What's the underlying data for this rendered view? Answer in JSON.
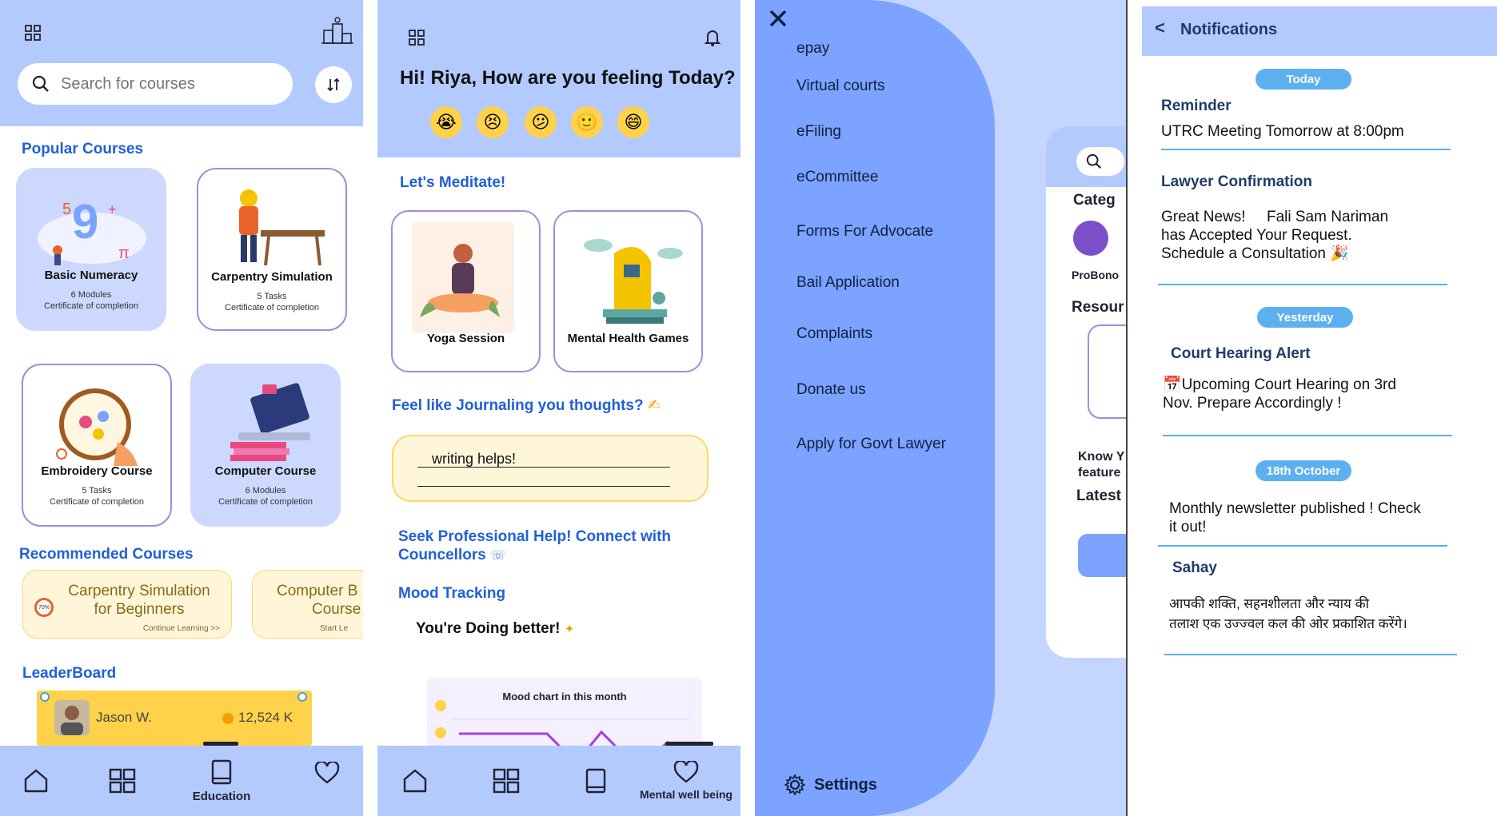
{
  "education": {
    "search_placeholder": "Search for courses",
    "popular_title": "Popular Courses",
    "courses": [
      {
        "name": "Basic Numeracy",
        "line1": "6 Modules",
        "line2": "Certificate of completion"
      },
      {
        "name": "Carpentry Simulation",
        "line1": "5 Tasks",
        "line2": "Certificate of completion"
      },
      {
        "name": "Embroidery Course",
        "line1": "5 Tasks",
        "line2": "Certificate of completion"
      },
      {
        "name": "Computer Course",
        "line1": "6 Modules",
        "line2": "Certificate of completion"
      }
    ],
    "recommended_title": "Recommended Courses",
    "recommended": [
      {
        "line1": "Carpentry Simulation",
        "line2": "for Beginners",
        "progress": "70%",
        "action": "Continue Learning >>"
      },
      {
        "line1": "Computer B",
        "line2": "Course",
        "action": "Start Le"
      }
    ],
    "leaderboard_title": "LeaderBoard",
    "leader": {
      "name": "Jason W.",
      "score": "12,524 K"
    },
    "nav": {
      "education_label": "Education"
    }
  },
  "wellbeing": {
    "greeting": "Hi! Riya, How are you feeling Today?",
    "emojis": [
      "😭",
      "😣",
      "😕",
      "🙂",
      "😄"
    ],
    "meditate_title": "Let's Meditate!",
    "meditations": [
      {
        "name": "Yoga Session"
      },
      {
        "name": "Mental Health Games"
      }
    ],
    "journal_title": "Feel like Journaling you thoughts?",
    "journal_text": "writing helps!",
    "help_line1": "Seek Professional Help!  Connect with",
    "help_line2": "Councellors",
    "mood_title": "Mood Tracking",
    "mood_text": "You're Doing better!",
    "chart_title": "Mood chart in this month",
    "nav": {
      "wellbeing_label": "Mental well being"
    }
  },
  "drawer": {
    "items": [
      "epay",
      "Virtual courts",
      "eFiling",
      "eCommittee",
      "Forms For Advocate",
      "Bail Application",
      "Complaints",
      "Donate us",
      "Apply for Govt Lawyer"
    ],
    "settings": "Settings",
    "behind": {
      "categ": "Categ",
      "probono": "ProBono",
      "resour": "Resour",
      "know": "Know Y",
      "feature": "feature",
      "latest": "Latest"
    }
  },
  "notifications": {
    "title": "Notifications",
    "groups": [
      {
        "pill": "Today"
      },
      {
        "pill": "Yesterday"
      },
      {
        "pill": "18th October"
      }
    ],
    "items": [
      {
        "title": "Reminder",
        "body": "UTRC Meeting Tomorrow at 8:00pm"
      },
      {
        "title": "Lawyer Confirmation",
        "body1": "Great News!     Fali Sam Nariman",
        "body2": "has Accepted Your Request.",
        "body3": "Schedule a Consultation 🎉"
      },
      {
        "title": "Court Hearing Alert",
        "body1": "📅Upcoming Court Hearing on 3rd",
        "body2": "Nov. Prepare Accordingly !"
      },
      {
        "body1": "Monthly newsletter published ! Check",
        "body2": "it out!"
      },
      {
        "title": "Sahay",
        "body1": "आपकी शक्ति, सहनशीलता और न्याय की",
        "body2": "तलाश एक उज्ज्वल कल की ओर प्रकाशित करेंगे।"
      }
    ]
  }
}
